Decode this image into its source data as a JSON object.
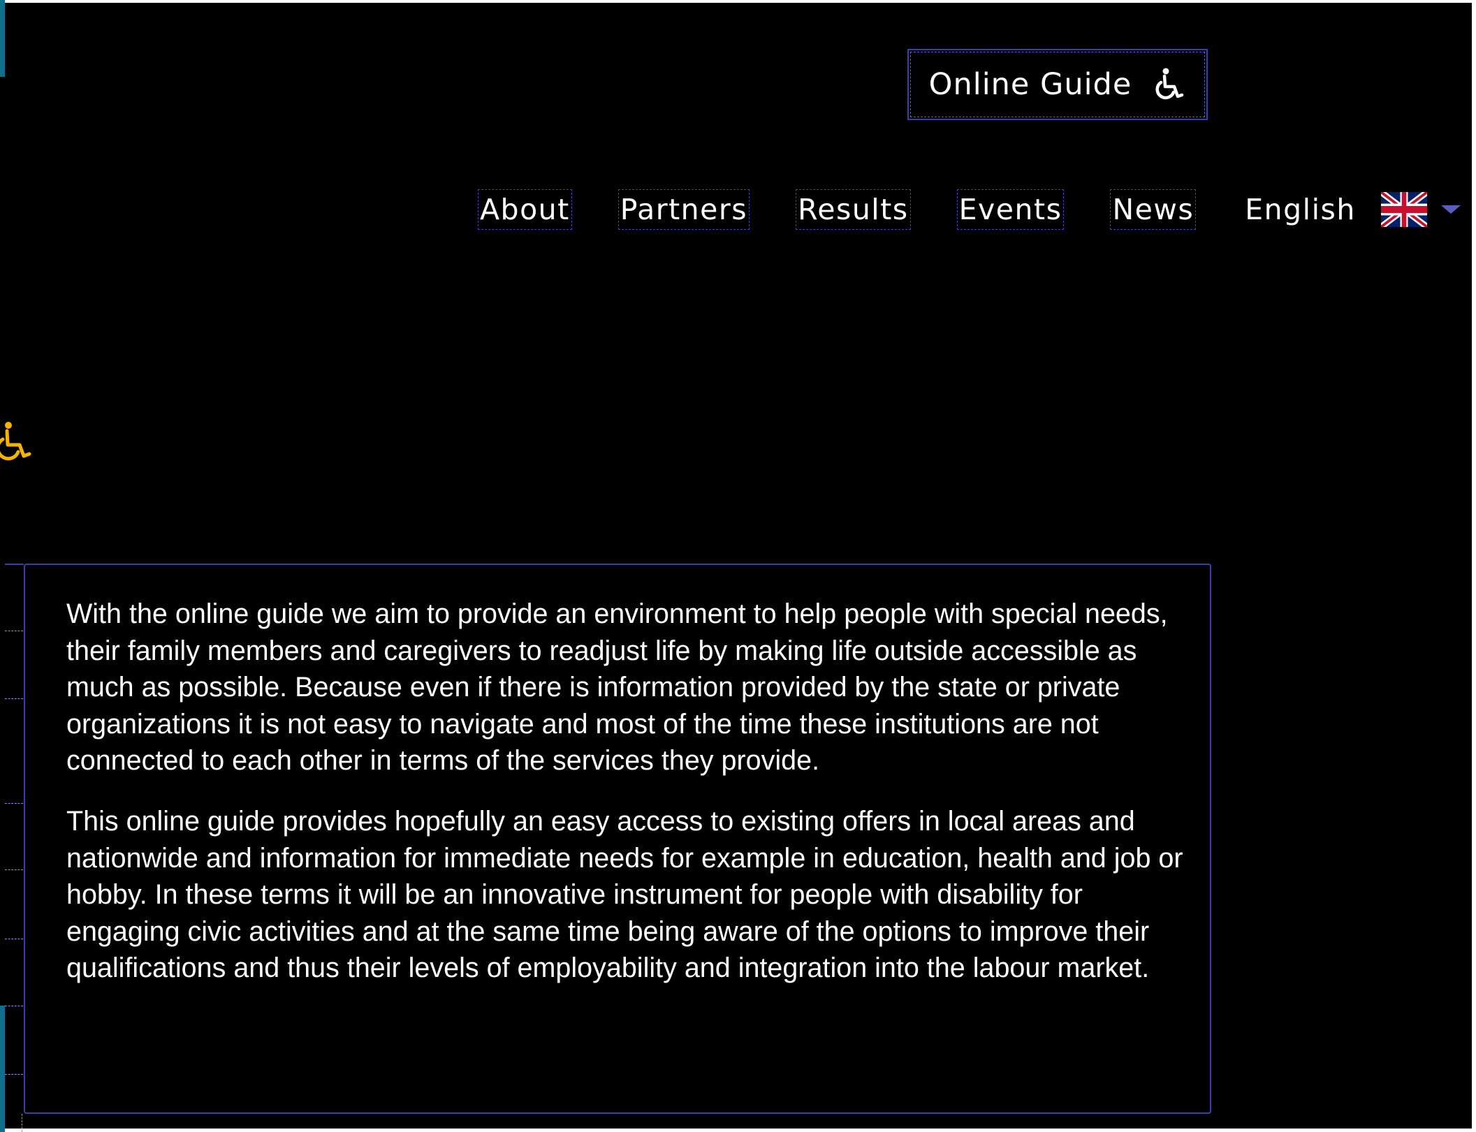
{
  "header": {
    "online_guide_label": "Online Guide",
    "online_guide_icon": "wheelchair-icon"
  },
  "nav": {
    "items": [
      {
        "label": "About"
      },
      {
        "label": "Partners"
      },
      {
        "label": "Results"
      },
      {
        "label": "Events"
      },
      {
        "label": "News"
      }
    ],
    "language": {
      "label": "English",
      "flag": "uk-flag-icon",
      "dropdown_icon": "caret-down-icon"
    }
  },
  "content": {
    "paragraphs": [
      "With the online guide we aim to provide an environment to help people with special needs, their family members and caregivers to readjust life by making life outside accessible as much as possible. Because even if there is information provided by the state or private organizations it is not easy to navigate and most of the time these institutions are not connected to each other in terms of the services they provide.",
      "This online guide provides hopefully an easy access to existing offers in local areas and nationwide and information for immediate needs for example in education, health and job or hobby. In these terms it will be an innovative instrument for people with disability for engaging civic activities and at the same time being aware of the options to improve their qualifications and thus their levels of employability and integration into the labour market."
    ]
  },
  "colors": {
    "background": "#000000",
    "text": "#ffffff",
    "accent_border": "#3a3fae",
    "side_icon": "#f5b400"
  }
}
